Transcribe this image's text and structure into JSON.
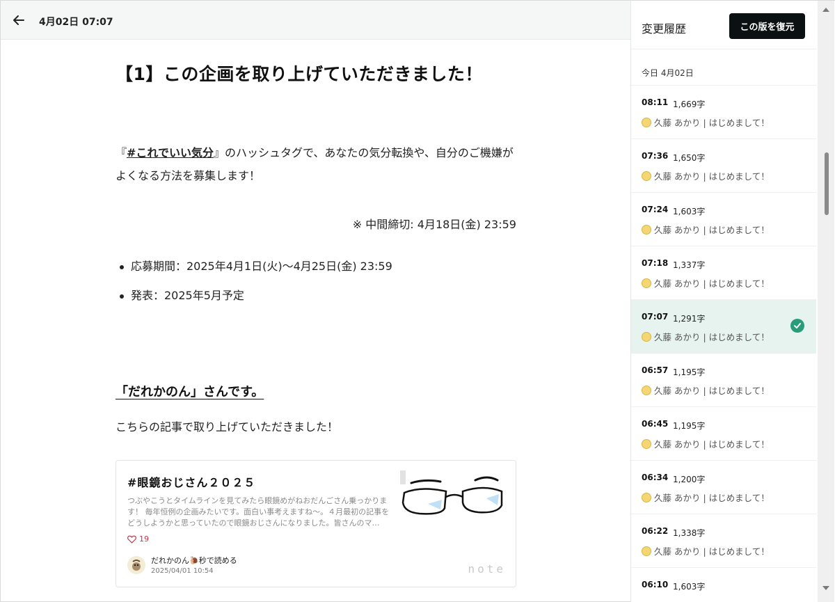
{
  "topbar": {
    "title": "4月02日 07:07"
  },
  "article": {
    "heading": "【1】この企画を取り上げていただきました！",
    "intro_prefix": "『",
    "hashtag": "#これでいい気分",
    "intro_suffix": "』のハッシュタグで、あなたの気分転換や、自分のご機嫌がよくなる方法を募集します！",
    "deadline_note": "※ 中間締切: 4月18日(金) 23:59",
    "bullets": [
      "応募期間：2025年4月1日(火)〜4月25日(金) 23:59",
      "発表：2025年5月予定"
    ],
    "subheading": "「だれかのん」さんです。",
    "body": "こちらの記事で取り上げていただきました！",
    "card": {
      "title": "#眼鏡おじさん２０２５",
      "excerpt": "つぶやこうとタイムラインを見てみたら眼鏡めがねおだんごさん乗っかります！ 毎年恒例の企画みたいです。面白い事考えますね〜。４月最初の記事をどうしようかと思っていたので眼鏡おじさんになりました。皆さんのマ…",
      "likes": "19",
      "author": "だれかのん🐌秒で読める",
      "date": "2025/04/01 10:54",
      "logo": "note"
    }
  },
  "sidebar": {
    "title": "変更履歴",
    "restore_label": "この版を復元",
    "date_label": "今日 4月02日",
    "versions": [
      {
        "time": "08:11",
        "count": "1,669字",
        "author": "久藤 あかり | はじめまして！"
      },
      {
        "time": "07:36",
        "count": "1,650字",
        "author": "久藤 あかり | はじめまして！"
      },
      {
        "time": "07:24",
        "count": "1,603字",
        "author": "久藤 あかり | はじめまして！"
      },
      {
        "time": "07:18",
        "count": "1,337字",
        "author": "久藤 あかり | はじめまして！"
      },
      {
        "time": "07:07",
        "count": "1,291字",
        "author": "久藤 あかり | はじめまして！",
        "active": true
      },
      {
        "time": "06:57",
        "count": "1,195字",
        "author": "久藤 あかり | はじめまして！"
      },
      {
        "time": "06:45",
        "count": "1,195字",
        "author": "久藤 あかり | はじめまして！"
      },
      {
        "time": "06:34",
        "count": "1,200字",
        "author": "久藤 あかり | はじめまして！"
      },
      {
        "time": "06:22",
        "count": "1,338字",
        "author": "久藤 あかり | はじめまして！"
      },
      {
        "time": "06:10",
        "count": "1,603字",
        "author": ""
      }
    ]
  },
  "icons": {
    "back": "arrow-left-icon",
    "check": "check-circle-icon",
    "heart": "heart-icon"
  },
  "colors": {
    "accent": "#2b9c79",
    "restore_button": "#0b1013",
    "active_row": "#e6f3ef",
    "like": "#c0394b"
  }
}
